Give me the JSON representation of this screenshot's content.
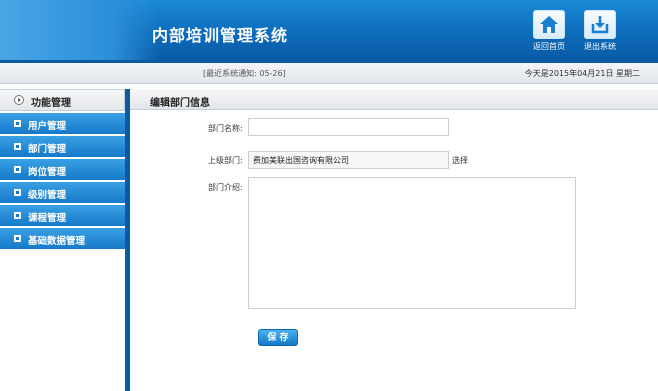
{
  "header": {
    "title": "内部培训管理系统",
    "home_label": "返回首页",
    "exit_label": "退出系统"
  },
  "notice": {
    "message": "[最近系统通知: 05-26]",
    "date": "今天是2015年04月21日 星期二"
  },
  "sidebar": {
    "title": "功能管理",
    "items": [
      {
        "label": "用户管理"
      },
      {
        "label": "部门管理"
      },
      {
        "label": "岗位管理"
      },
      {
        "label": "级别管理"
      },
      {
        "label": "课程管理"
      },
      {
        "label": "基础数据管理"
      }
    ]
  },
  "form": {
    "title": "编辑部门信息",
    "name_label": "部门名称:",
    "name_value": "",
    "parent_label": "上级部门:",
    "parent_value": "费加美联出国咨询有限公司",
    "choose_label": "选择",
    "intro_label": "部门介绍:",
    "intro_value": "",
    "save_label": "保 存"
  },
  "colors": {
    "header_blue": "#0d6cbb",
    "menu_blue": "#1579c9",
    "dark_rule": "#0a5aa4"
  }
}
